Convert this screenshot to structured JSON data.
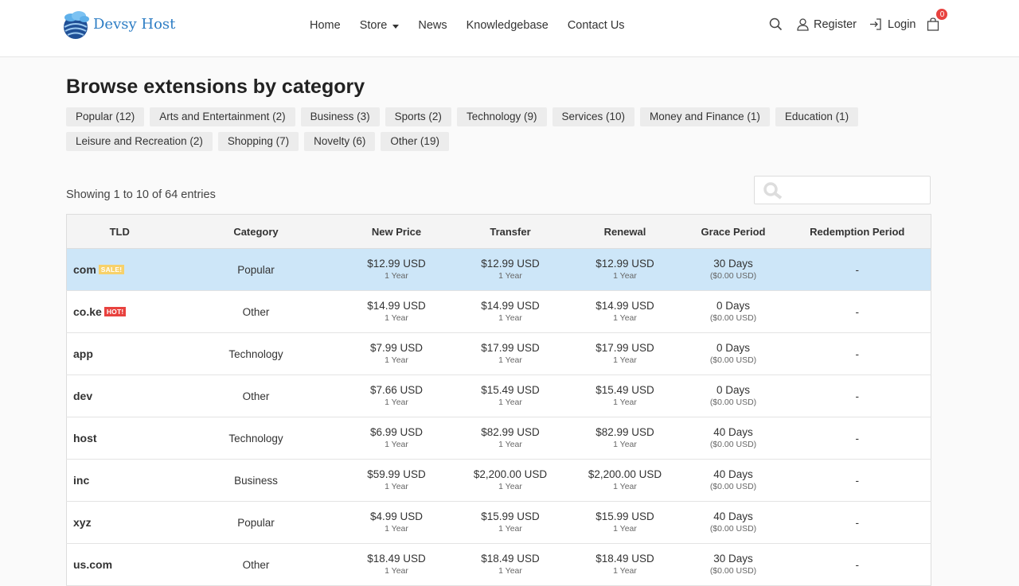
{
  "brand": {
    "name": "Devsy Host"
  },
  "nav": {
    "home": "Home",
    "store": "Store",
    "news": "News",
    "knowledgebase": "Knowledgebase",
    "contact": "Contact Us"
  },
  "right_nav": {
    "register": "Register",
    "login": "Login",
    "cart_count": "0"
  },
  "page_title": "Browse extensions by category",
  "categories": [
    "Popular (12)",
    "Arts and Entertainment (2)",
    "Business (3)",
    "Sports (2)",
    "Technology (9)",
    "Services (10)",
    "Money and Finance (1)",
    "Education (1)",
    "Leisure and Recreation (2)",
    "Shopping (7)",
    "Novelty (6)",
    "Other (19)"
  ],
  "showing_text": "Showing 1 to 10 of 64 entries",
  "table": {
    "headers": [
      "TLD",
      "Category",
      "New Price",
      "Transfer",
      "Renewal",
      "Grace Period",
      "Redemption Period"
    ],
    "rows": [
      {
        "tld": "com",
        "tag": "SALE!",
        "category": "Popular",
        "new": "$12.99 USD",
        "new_term": "1 Year",
        "transfer": "$12.99 USD",
        "transfer_term": "1 Year",
        "renewal": "$12.99 USD",
        "renewal_term": "1 Year",
        "grace": "30 Days",
        "grace_fee": "($0.00 USD)",
        "redemption": "-"
      },
      {
        "tld": "co.ke",
        "tag": "HOT!",
        "category": "Other",
        "new": "$14.99 USD",
        "new_term": "1 Year",
        "transfer": "$14.99 USD",
        "transfer_term": "1 Year",
        "renewal": "$14.99 USD",
        "renewal_term": "1 Year",
        "grace": "0 Days",
        "grace_fee": "($0.00 USD)",
        "redemption": "-"
      },
      {
        "tld": "app",
        "tag": "",
        "category": "Technology",
        "new": "$7.99 USD",
        "new_term": "1 Year",
        "transfer": "$17.99 USD",
        "transfer_term": "1 Year",
        "renewal": "$17.99 USD",
        "renewal_term": "1 Year",
        "grace": "0 Days",
        "grace_fee": "($0.00 USD)",
        "redemption": "-"
      },
      {
        "tld": "dev",
        "tag": "",
        "category": "Other",
        "new": "$7.66 USD",
        "new_term": "1 Year",
        "transfer": "$15.49 USD",
        "transfer_term": "1 Year",
        "renewal": "$15.49 USD",
        "renewal_term": "1 Year",
        "grace": "0 Days",
        "grace_fee": "($0.00 USD)",
        "redemption": "-"
      },
      {
        "tld": "host",
        "tag": "",
        "category": "Technology",
        "new": "$6.99 USD",
        "new_term": "1 Year",
        "transfer": "$82.99 USD",
        "transfer_term": "1 Year",
        "renewal": "$82.99 USD",
        "renewal_term": "1 Year",
        "grace": "40 Days",
        "grace_fee": "($0.00 USD)",
        "redemption": "-"
      },
      {
        "tld": "inc",
        "tag": "",
        "category": "Business",
        "new": "$59.99 USD",
        "new_term": "1 Year",
        "transfer": "$2,200.00 USD",
        "transfer_term": "1 Year",
        "renewal": "$2,200.00 USD",
        "renewal_term": "1 Year",
        "grace": "40 Days",
        "grace_fee": "($0.00 USD)",
        "redemption": "-"
      },
      {
        "tld": "xyz",
        "tag": "",
        "category": "Popular",
        "new": "$4.99 USD",
        "new_term": "1 Year",
        "transfer": "$15.99 USD",
        "transfer_term": "1 Year",
        "renewal": "$15.99 USD",
        "renewal_term": "1 Year",
        "grace": "40 Days",
        "grace_fee": "($0.00 USD)",
        "redemption": "-"
      },
      {
        "tld": "us.com",
        "tag": "",
        "category": "Other",
        "new": "$18.49 USD",
        "new_term": "1 Year",
        "transfer": "$18.49 USD",
        "transfer_term": "1 Year",
        "renewal": "$18.49 USD",
        "renewal_term": "1 Year",
        "grace": "30 Days",
        "grace_fee": "($0.00 USD)",
        "redemption": "-"
      }
    ]
  },
  "icons": {
    "logo": "cloud-globe-logo",
    "search": "search-icon",
    "register": "user-icon",
    "login": "sign-in-icon",
    "cart": "shopping-bag-icon"
  },
  "colors": {
    "accent": "#2d7dc4",
    "highlight_row": "#cde6f8",
    "sale_tag": "#f7d16a",
    "hot_tag": "#e8423f",
    "cart_badge": "#e8423f"
  }
}
